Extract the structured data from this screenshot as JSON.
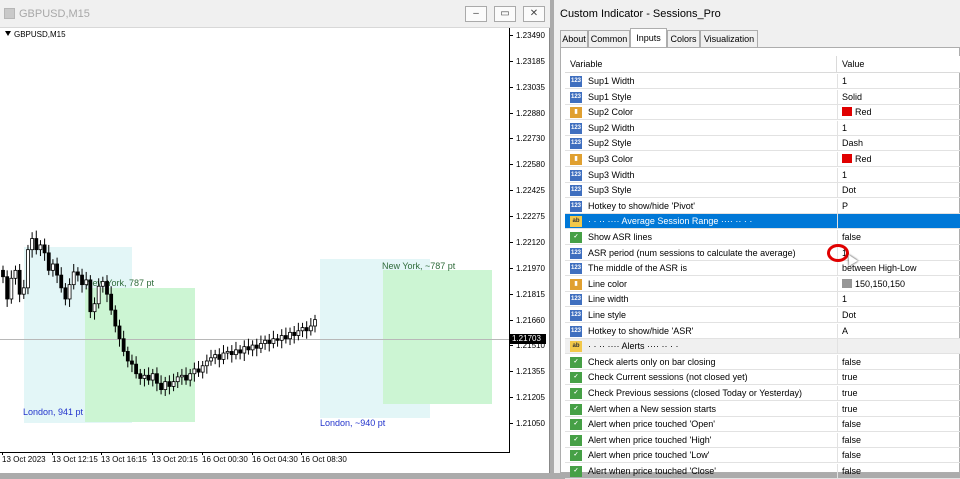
{
  "chart_window": {
    "title": "GBPUSD,M15",
    "symbol": "GBPUSD,M15",
    "minimize": "‒",
    "restore": "▭",
    "close": "✕",
    "current_price": "1.21703",
    "price_labels": [
      "1.23490",
      "1.23185",
      "1.23035",
      "1.22880",
      "1.22730",
      "1.22580",
      "1.22425",
      "1.22275",
      "1.22120",
      "1.21970",
      "1.21815",
      "1.21660",
      "1.21510",
      "1.21355",
      "1.21205",
      "1.21050"
    ],
    "time_labels": [
      "13 Oct 2023",
      "13 Oct 12:15",
      "13 Oct 16:15",
      "13 Oct 20:15",
      "16 Oct 00:30",
      "16 Oct 04:30",
      "16 Oct 08:30"
    ],
    "sessions": {
      "ny_prev": "New York, 787 pt",
      "ny_cur": "New York, ~787 pt",
      "london_prev": "London, 941 pt",
      "london_cur": "London, ~940 pt"
    }
  },
  "chart_data": {
    "type": "candlestick",
    "title": "GBPUSD,M15",
    "categories": [
      "13 Oct 2023",
      "13 Oct 12:15",
      "13 Oct 16:15",
      "13 Oct 20:15",
      "16 Oct 00:30",
      "16 Oct 04:30",
      "16 Oct 08:30"
    ],
    "ylim": [
      1.2105,
      1.2349
    ],
    "close": [
      1.2197,
      1.2183,
      1.2196,
      1.2201,
      1.2186,
      1.219,
      1.2214,
      1.2221,
      1.2214,
      1.2217,
      1.2212,
      1.2201,
      1.2205,
      1.2198,
      1.219,
      1.2183,
      1.2192,
      1.22,
      1.2198,
      1.2192,
      1.2195,
      1.2175,
      1.218,
      1.2191,
      1.2194,
      1.2186,
      1.2176,
      1.2166,
      1.2158,
      1.215,
      1.2144,
      1.2142,
      1.2136,
      1.2133,
      1.2135,
      1.2132,
      1.2136,
      1.213,
      1.2126,
      1.2131,
      1.2128,
      1.2131,
      1.2134,
      1.2135,
      1.2132,
      1.2136,
      1.2139,
      1.2137,
      1.2141,
      1.2144,
      1.2146,
      1.2148,
      1.2145,
      1.2149,
      1.215,
      1.2148,
      1.2151,
      1.2149,
      1.2153,
      1.2151,
      1.2154,
      1.2152,
      1.2155,
      1.2157,
      1.2155,
      1.2158,
      1.2157,
      1.216,
      1.2158,
      1.2162,
      1.216,
      1.2163,
      1.2165,
      1.2163,
      1.2166,
      1.217
    ]
  },
  "dialog": {
    "title": "Custom Indicator - Sessions_Pro",
    "tabs": [
      "About",
      "Common",
      "Inputs",
      "Colors",
      "Visualization"
    ],
    "headers": {
      "variable": "Variable",
      "value": "Value"
    },
    "rows": [
      {
        "icon": "123",
        "var": "Sup1 Width",
        "val": "1"
      },
      {
        "icon": "123",
        "var": "Sup1 Style",
        "val": "Solid"
      },
      {
        "icon": "col",
        "var": "Sup2 Color",
        "val": "Red",
        "color": "#e00000"
      },
      {
        "icon": "123",
        "var": "Sup2 Width",
        "val": "1"
      },
      {
        "icon": "123",
        "var": "Sup2 Style",
        "val": "Dash"
      },
      {
        "icon": "col",
        "var": "Sup3 Color",
        "val": "Red",
        "color": "#e00000"
      },
      {
        "icon": "123",
        "var": "Sup3 Width",
        "val": "1"
      },
      {
        "icon": "123",
        "var": "Sup3 Style",
        "val": "Dot"
      },
      {
        "icon": "123",
        "var": "Hotkey to show/hide 'Pivot'",
        "val": "P"
      },
      {
        "icon": "ab",
        "var": "·   ·   ·· ···· Average Session Range ···· ·· ·   ·",
        "val": ""
      },
      {
        "icon": "bool",
        "var": "Show ASR lines",
        "val": "false"
      },
      {
        "icon": "123",
        "var": "ASR period (num sessions to calculate the average)",
        "val": "1"
      },
      {
        "icon": "123",
        "var": "The middle of the ASR is",
        "val": "between High-Low"
      },
      {
        "icon": "col",
        "var": "Line color",
        "val": "150,150,150",
        "color": "#969696"
      },
      {
        "icon": "123",
        "var": "Line width",
        "val": "1"
      },
      {
        "icon": "123",
        "var": "Line style",
        "val": "Dot"
      },
      {
        "icon": "123",
        "var": "Hotkey to show/hide 'ASR'",
        "val": "A"
      },
      {
        "icon": "ab",
        "var": "·   ·   ·· ···· Alerts ···· ·· ·   ·",
        "val": ""
      },
      {
        "icon": "bool",
        "var": "Check alerts only on bar closing",
        "val": "false"
      },
      {
        "icon": "bool",
        "var": "Check Current sessions (not closed yet)",
        "val": "true"
      },
      {
        "icon": "bool",
        "var": "Check Previous sessions (closed Today or Yesterday)",
        "val": "true"
      },
      {
        "icon": "bool",
        "var": "Alert when a New session starts",
        "val": "true"
      },
      {
        "icon": "bool",
        "var": "Alert when price touched 'Open'",
        "val": "false"
      },
      {
        "icon": "bool",
        "var": "Alert when price touched 'High'",
        "val": "false"
      },
      {
        "icon": "bool",
        "var": "Alert when price touched 'Low'",
        "val": "false"
      },
      {
        "icon": "bool",
        "var": "Alert when price touched 'Close'",
        "val": "false"
      }
    ]
  }
}
